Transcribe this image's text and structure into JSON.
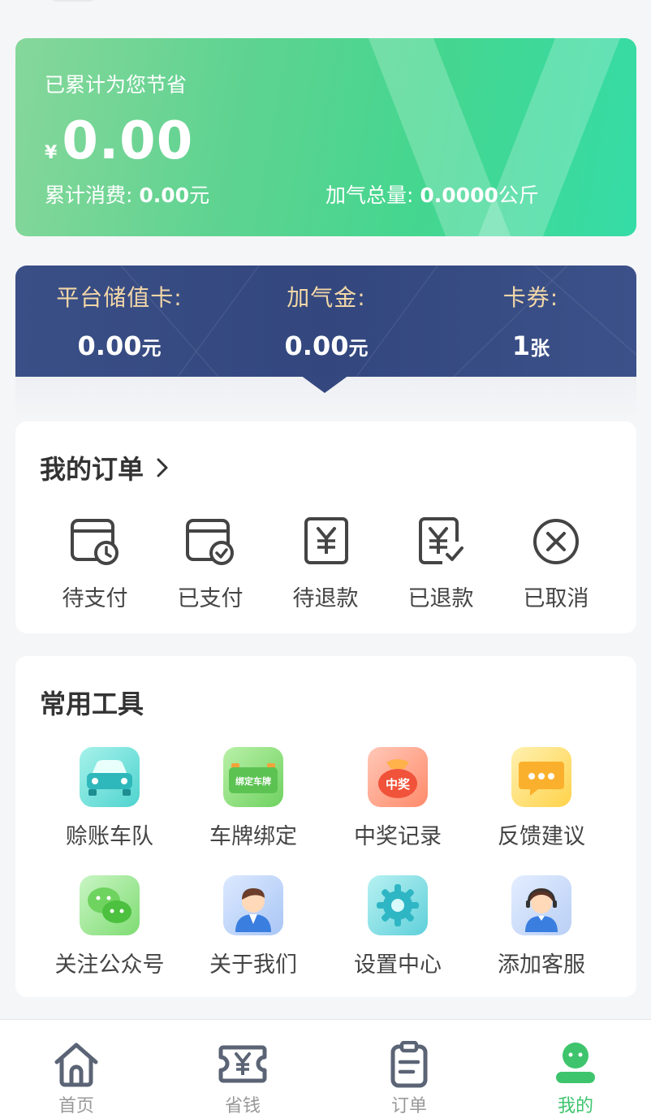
{
  "savings": {
    "title": "已累计为您节省",
    "currency": "¥",
    "amount": "0.00",
    "spend_label": "累计消费:",
    "spend_value": "0.00",
    "spend_unit": "元",
    "gas_label": "加气总量:",
    "gas_value": "0.0000",
    "gas_unit": "公斤"
  },
  "wallet": {
    "items": [
      {
        "label": "平台储值卡:",
        "value": "0.00",
        "unit": "元"
      },
      {
        "label": "加气金:",
        "value": "0.00",
        "unit": "元"
      },
      {
        "label": "卡券:",
        "value": "1",
        "unit": "张"
      }
    ]
  },
  "orders": {
    "title": "我的订单",
    "items": [
      {
        "label": "待支付",
        "icon": "card-clock-icon"
      },
      {
        "label": "已支付",
        "icon": "card-check-icon"
      },
      {
        "label": "待退款",
        "icon": "yuan-doc-icon"
      },
      {
        "label": "已退款",
        "icon": "yuan-doc-check-icon"
      },
      {
        "label": "已取消",
        "icon": "circle-x-icon"
      }
    ]
  },
  "tools": {
    "title": "常用工具",
    "items": [
      {
        "label": "赊账车队",
        "icon": "car-icon"
      },
      {
        "label": "车牌绑定",
        "icon": "plate-bind-icon",
        "badge": "绑定车牌"
      },
      {
        "label": "中奖记录",
        "icon": "prize-bag-icon",
        "badge": "中奖"
      },
      {
        "label": "反馈建议",
        "icon": "chat-bubble-icon"
      },
      {
        "label": "关注公众号",
        "icon": "wechat-icon"
      },
      {
        "label": "关于我们",
        "icon": "person-icon"
      },
      {
        "label": "设置中心",
        "icon": "gear-icon"
      },
      {
        "label": "添加客服",
        "icon": "service-agent-icon"
      }
    ]
  },
  "tabbar": {
    "items": [
      {
        "label": "首页",
        "icon": "home-icon"
      },
      {
        "label": "省钱",
        "icon": "coupon-icon"
      },
      {
        "label": "订单",
        "icon": "clipboard-icon"
      },
      {
        "label": "我的",
        "icon": "user-icon",
        "active": true
      }
    ]
  },
  "colors": {
    "accent": "#3ec46d",
    "wallet_bg": "#34487f",
    "wallet_label": "#f3d7a8"
  }
}
